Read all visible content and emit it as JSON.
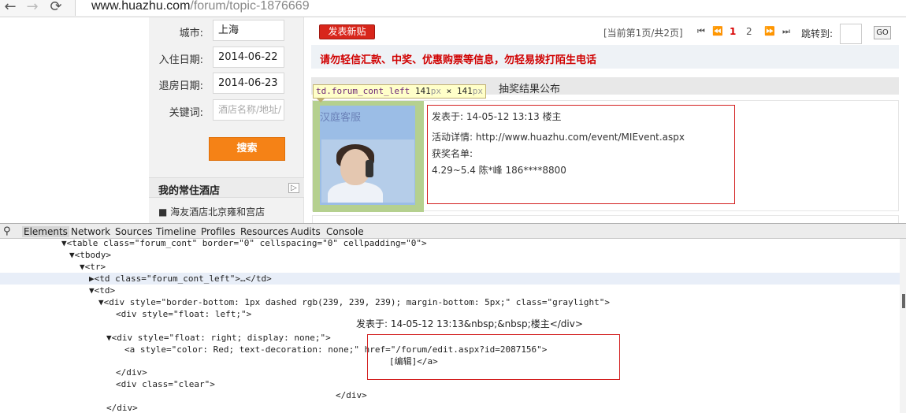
{
  "browser": {
    "back_icon": "back-arrow-icon",
    "forward_icon": "forward-arrow-icon",
    "reload_icon": "reload-icon",
    "url_host": "www.huazhu.com",
    "url_path": "/forum/topic-1876669"
  },
  "sidebar": {
    "city_label": "城市:",
    "city_value": "上海",
    "checkin_label": "入住日期:",
    "checkin_value": "2014-06-22",
    "checkout_label": "退房日期:",
    "checkout_value": "2014-06-23",
    "keyword_label": "关键词:",
    "keyword_placeholder": "酒店名称/地址/",
    "search_label": "搜索",
    "fav_title": "我的常住酒店",
    "fav_more": "▷",
    "fav_item": "■   海友酒店北京雍和宫店"
  },
  "forum": {
    "new_post_label": "发表新贴",
    "page_info": "[当前第1页/共2页]",
    "pages": [
      "1",
      "2"
    ],
    "jump_label": "跳转到:",
    "go_label": "GO",
    "warning": "请勿轻信汇款、中奖、优惠购票等信息，勿轻易拨打陌生电话",
    "topic_title": "抽奖结果公布",
    "author": "汉庭客服",
    "post_time_line": "发表于: 14-05-12 13:13   楼主",
    "detail_line": "活动详情: http://www.huazhu.com/event/MIEvent.aspx",
    "winners_label": "获奖名单:",
    "winner_line": "4.29~5.4  陈*峰   186****8800"
  },
  "tooltip": {
    "tag": "td.forum_cont_left",
    "size": "141",
    "unit": "px",
    "times": "×"
  },
  "devtools": {
    "tabs": [
      "Elements",
      "Network",
      "Sources",
      "Timeline",
      "Profiles",
      "Resources",
      "Audits",
      "Console"
    ],
    "active_tab": "Elements",
    "lines": [
      "▼<table class=\"forum_cont\" border=\"0\" cellspacing=\"0\" cellpadding=\"0\">",
      "▼<tbody>",
      "▼<tr>",
      "▶<td class=\"forum_cont_left\">…</td>",
      "▼<td>",
      "▼<div style=\"border-bottom: 1px dashed rgb(239, 239, 239); margin-bottom: 5px;\" class=\"graylight\">",
      "<div style=\"float: left;\">",
      "发表于: 14-05-12 13:13&nbsp;&nbsp;楼主</div>",
      "▼<div style=\"float: right; display: none;\">",
      "<a style=\"color: Red; text-decoration: none;\" href=\"/forum/edit.aspx?id=2087156\">",
      "[编辑]</a>",
      "</div>",
      "<div class=\"clear\">",
      "</div>",
      "</div>"
    ]
  },
  "colors": {
    "accent_orange": "#f58216",
    "warning_red": "#d00000",
    "highlight_red_box": "#d32020"
  }
}
